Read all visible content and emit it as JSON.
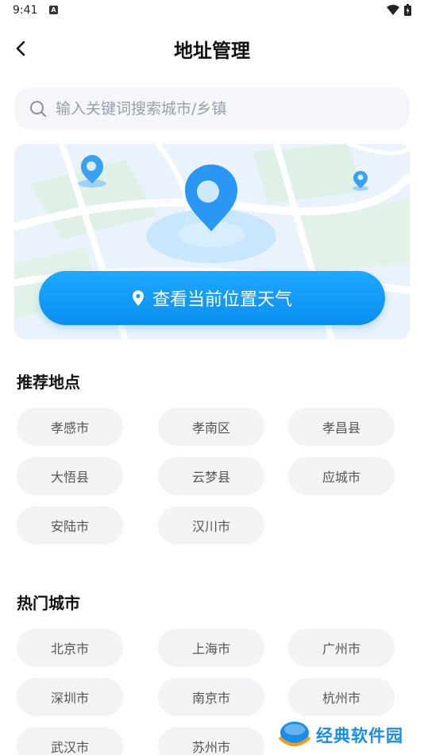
{
  "status_bar": {
    "time": "9:41"
  },
  "header": {
    "title": "地址管理"
  },
  "search": {
    "placeholder": "输入关键词搜索城市/乡镇"
  },
  "map_card": {
    "button_label": "查看当前位置天气"
  },
  "recommended": {
    "title": "推荐地点",
    "items": [
      "孝感市",
      "孝南区",
      "孝昌县",
      "大悟县",
      "云梦县",
      "应城市",
      "安陆市",
      "汉川市"
    ]
  },
  "hot_cities": {
    "title": "热门城市",
    "items": [
      "北京市",
      "上海市",
      "广州市",
      "深圳市",
      "南京市",
      "杭州市",
      "武汉市",
      "苏州市"
    ]
  },
  "watermark": {
    "text": "经典软件园"
  },
  "colors": {
    "accent": "#0a8ff0",
    "chip_bg": "#f2f3f5",
    "search_bg": "#f4f6f9"
  }
}
